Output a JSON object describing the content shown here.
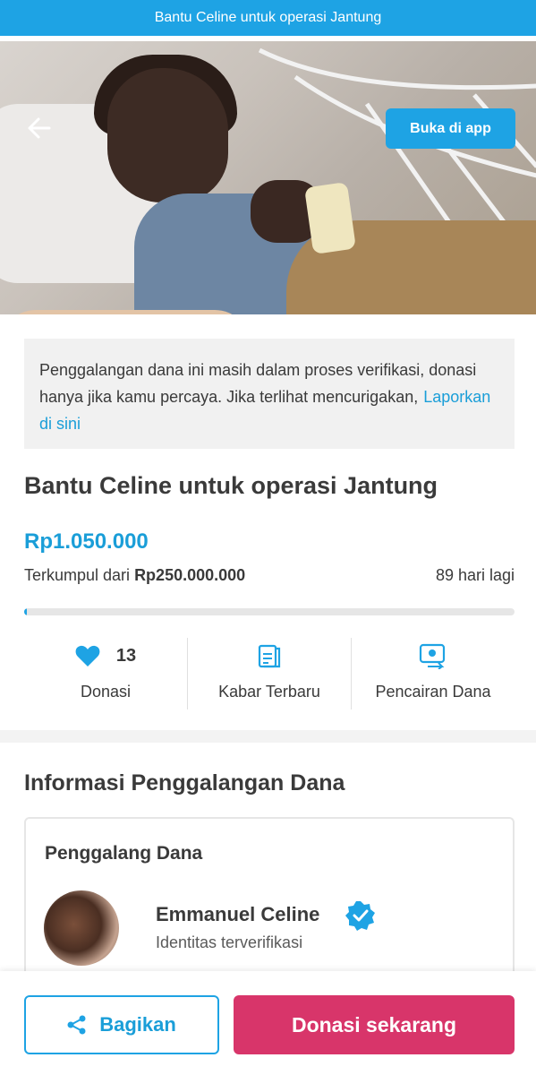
{
  "banner": {
    "title": "Bantu Celine untuk operasi Jantung"
  },
  "header": {
    "open_app_label": "Buka di app"
  },
  "notice": {
    "text": "Penggalangan dana ini masih dalam proses verifikasi, donasi hanya jika kamu percaya. Jika terlihat mencurigakan,",
    "link_label": "Laporkan di sini"
  },
  "campaign": {
    "title": "Bantu Celine untuk operasi Jantung",
    "raised": "Rp1.050.000",
    "target_prefix": "Terkumpul dari",
    "target_amount": "Rp250.000.000",
    "days_left": "89 hari lagi",
    "progress_fraction": 0.0042
  },
  "stats": {
    "donations_count": "13",
    "donations_label": "Donasi",
    "updates_label": "Kabar Terbaru",
    "withdrawals_label": "Pencairan Dana"
  },
  "info": {
    "section_title": "Informasi Penggalangan Dana",
    "card_title": "Penggalang Dana",
    "owner_name": "Emmanuel Celine",
    "owner_status": "Identitas terverifikasi"
  },
  "actions": {
    "share_label": "Bagikan",
    "donate_label": "Donasi sekarang"
  },
  "colors": {
    "primary": "#1ea3e4",
    "donate": "#d8356a"
  }
}
